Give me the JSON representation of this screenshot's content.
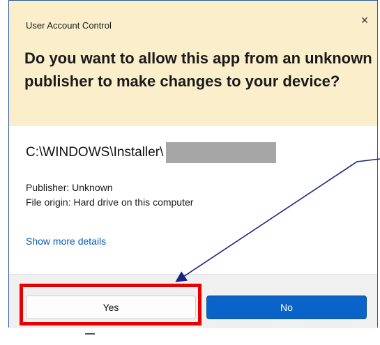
{
  "dialog": {
    "title": "User Account Control",
    "close_label": "×",
    "question": "Do you want to allow this app from an unknown publisher to make changes to your device?",
    "path": "C:\\WINDOWS\\Installer\\",
    "publisher": "Publisher: Unknown",
    "file_origin": "File origin: Hard drive on this computer",
    "details_link": "Show more details",
    "buttons": {
      "yes": "Yes",
      "no": "No"
    }
  },
  "colors": {
    "header_bg": "#fbeecb",
    "primary_button": "#0a63c9",
    "highlight": "#e60000",
    "arrow": "#1a237e"
  }
}
